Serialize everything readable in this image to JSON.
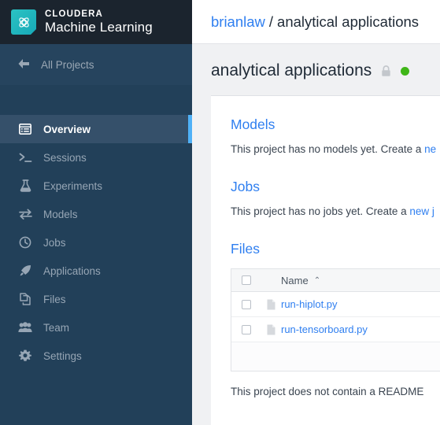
{
  "brand": {
    "line1": "CLOUDERA",
    "line2": "Machine Learning",
    "logo_icon": "cloudera-atom-logo-icon",
    "logo_color": "#22b8bd"
  },
  "sidebar": {
    "back_label": "All Projects",
    "back_icon": "arrow-left-icon",
    "active_accent_color": "#4fb1f7",
    "background_color": "#224059",
    "items": [
      {
        "label": "Overview",
        "icon": "overview-list-icon",
        "active": true
      },
      {
        "label": "Sessions",
        "icon": "terminal-prompt-icon",
        "active": false
      },
      {
        "label": "Experiments",
        "icon": "flask-icon",
        "active": false
      },
      {
        "label": "Models",
        "icon": "exchange-arrows-icon",
        "active": false
      },
      {
        "label": "Jobs",
        "icon": "clock-icon",
        "active": false
      },
      {
        "label": "Applications",
        "icon": "rocket-icon",
        "active": false
      },
      {
        "label": "Files",
        "icon": "files-copy-icon",
        "active": false
      },
      {
        "label": "Team",
        "icon": "people-group-icon",
        "active": false
      },
      {
        "label": "Settings",
        "icon": "gear-icon",
        "active": false
      }
    ]
  },
  "breadcrumb": {
    "user": "brianlaw",
    "separator": "/",
    "project": "analytical applications"
  },
  "page_header": {
    "title": "analytical applications",
    "lock_icon": "lock-icon",
    "status_dot_color": "#3fb618",
    "status_text": ""
  },
  "sections": {
    "models": {
      "title": "Models",
      "body_prefix": "This project has no models yet. Create a ",
      "link": "ne"
    },
    "jobs": {
      "title": "Jobs",
      "body_prefix": "This project has no jobs yet. Create a ",
      "link": "new j"
    },
    "files": {
      "title": "Files",
      "columns": [
        "Name"
      ],
      "sort_indicator": "⌃",
      "rows": [
        {
          "name": "run-hiplot.py",
          "icon": "file-document-icon",
          "checked": false
        },
        {
          "name": "run-tensorboard.py",
          "icon": "file-document-icon",
          "checked": false
        }
      ],
      "select_all_checked": false
    }
  },
  "readme_note": "This project does not contain a README"
}
